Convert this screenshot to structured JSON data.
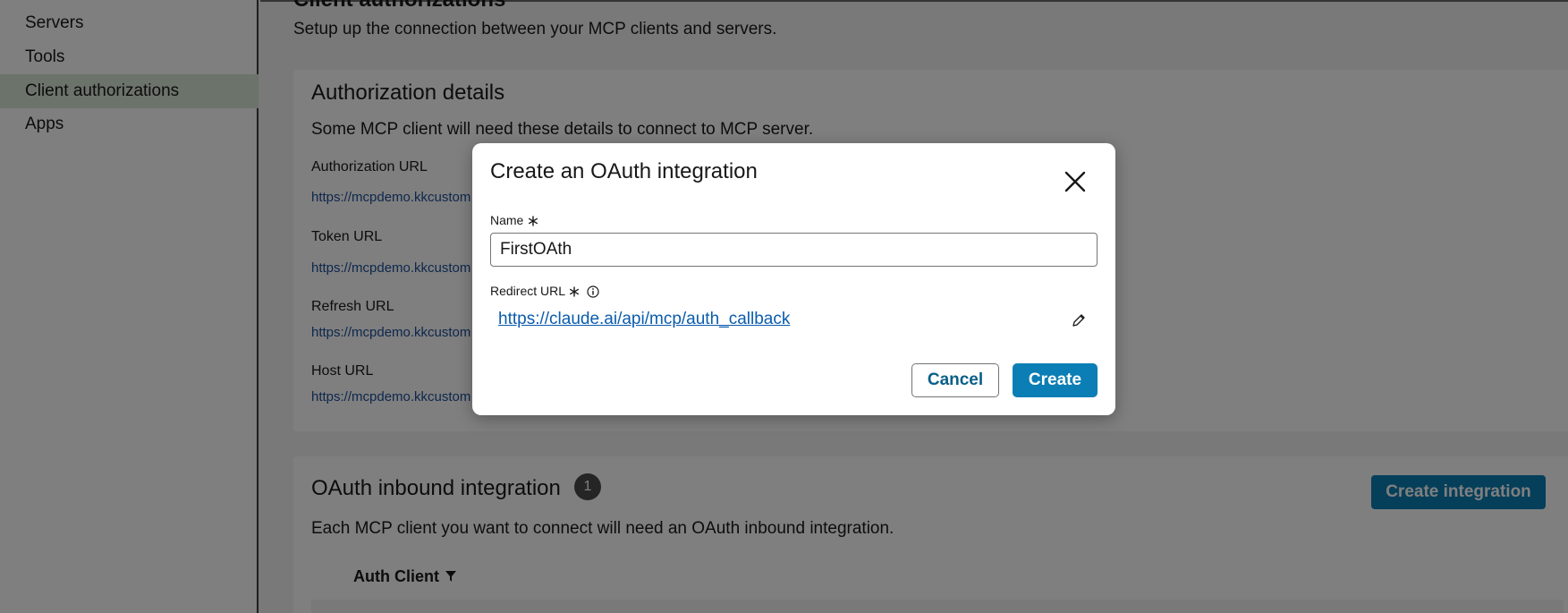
{
  "sidebar": {
    "items": [
      {
        "label": "Servers"
      },
      {
        "label": "Tools"
      },
      {
        "label": "Client authorizations",
        "active": true
      },
      {
        "label": "Apps"
      }
    ]
  },
  "page": {
    "title": "Client authorizations",
    "subtitle": "Setup up the connection between your MCP clients and servers."
  },
  "auth_details": {
    "heading": "Authorization details",
    "description": "Some MCP client will need these details to connect to MCP server.",
    "fields": [
      {
        "label": "Authorization URL",
        "value": "https://mcpdemo.kkcustom"
      },
      {
        "label": "Token URL",
        "value": "https://mcpdemo.kkcustom"
      },
      {
        "label": "Refresh URL",
        "value": "https://mcpdemo.kkcustom"
      },
      {
        "label": "Host URL",
        "value": "https://mcpdemo.kkcustom"
      }
    ]
  },
  "oauth_inbound": {
    "heading": "OAuth inbound integration",
    "count": "1",
    "description": "Each MCP client you want to connect will need an OAuth inbound integration.",
    "create_button": "Create integration",
    "column_header": "Auth Client"
  },
  "modal": {
    "title": "Create an OAuth integration",
    "name_label": "Name",
    "name_value": "FirstOAth",
    "redirect_label": "Redirect URL",
    "redirect_url": "https://claude.ai/api/mcp/auth_callback",
    "cancel_label": "Cancel",
    "create_label": "Create"
  },
  "icons": {
    "close": "close-icon",
    "required": "asterisk-icon",
    "info": "info-icon",
    "edit": "pencil-icon",
    "filter": "filter-icon"
  },
  "colors": {
    "primary_button": "#0b7eb5",
    "link": "#0b5cad",
    "active_nav": "#d8e6d6",
    "overlay": "rgba(0,0,0,0.5)"
  }
}
